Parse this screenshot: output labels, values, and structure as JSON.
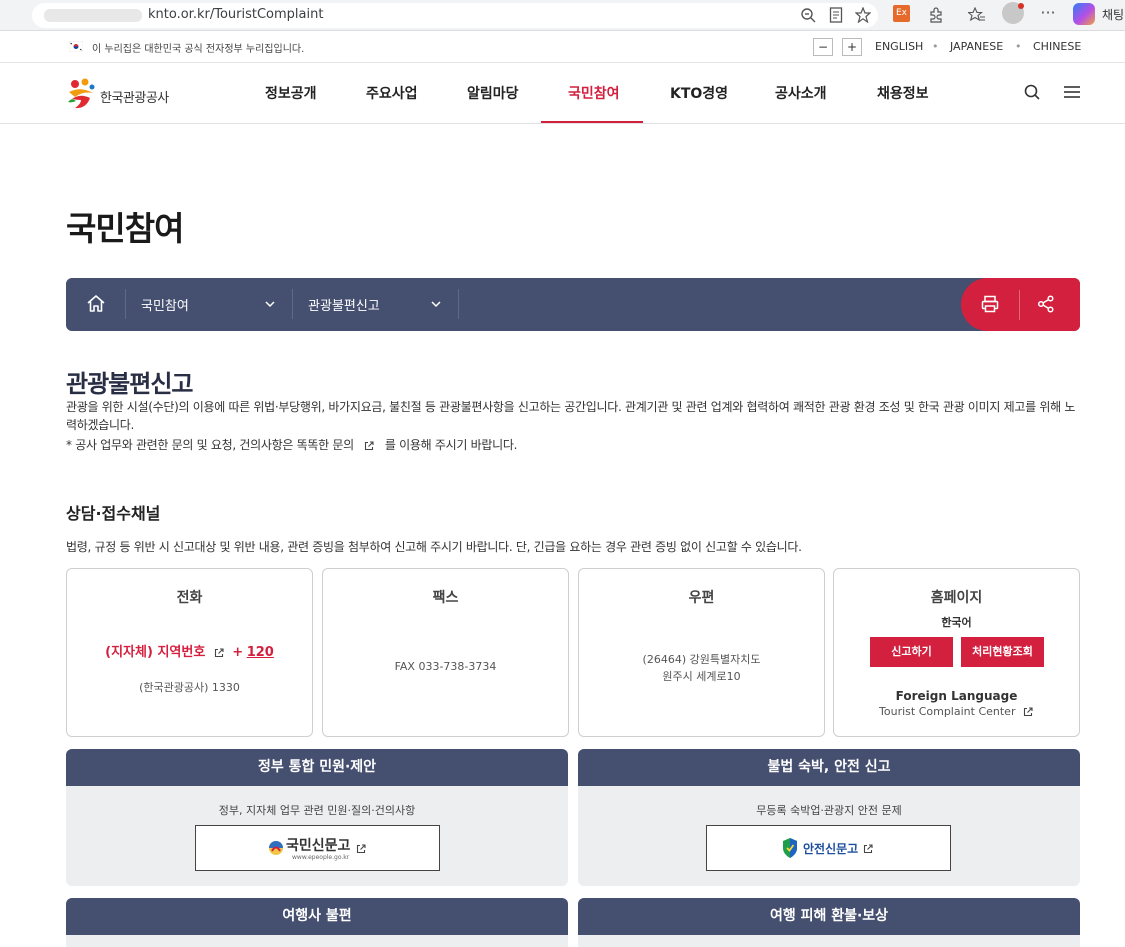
{
  "browser": {
    "url": "knto.or.kr/TouristComplaint",
    "ext_badge": "Ex",
    "chat_label": "채팅"
  },
  "gov": {
    "notice": "이 누리집은 대한민국 공식 전자정부 누리집입니다.",
    "font_minus": "−",
    "font_plus": "+",
    "languages": [
      "ENGLISH",
      "JAPANESE",
      "CHINESE"
    ]
  },
  "header": {
    "logo_text": "한국관광공사",
    "nav": [
      "정보공개",
      "주요사업",
      "알림마당",
      "국민참여",
      "KTO경영",
      "공사소개",
      "채용정보"
    ],
    "active_nav": "국민참여"
  },
  "page": {
    "title": "국민참여"
  },
  "breadcrumb": {
    "level1": "국민참여",
    "level2": "관광불편신고"
  },
  "section": {
    "title": "관광불편신고",
    "desc": "관광을 위한 시설(수단)의 이용에 따른 위법·부당행위, 바가지요금, 불친절 등 관광불편사항을 신고하는 공간입니다. 관계기관 및 관련 업계와 협력하여 쾌적한 관광 환경 조성 및 한국 관광 이미지 제고를 위해 노력하겠습니다.",
    "note_prefix": "* 공사 업무와 관련한 문의 및 요청, 건의사항은 똑똑한 문의",
    "note_suffix": "를 이용해 주시기 바랍니다."
  },
  "channels": {
    "title": "상담·접수채널",
    "desc": "법령, 규정 등 위반 시 신고대상 및 위반 내용, 관련 증빙을 첨부하여 신고해 주시기 바랍니다. 단, 긴급을 요하는 경우 관련 증빙 없이 신고할 수 있습니다.",
    "phone": {
      "title": "전화",
      "local_label": "(지자체) 지역번호",
      "plus": "+",
      "number": "120",
      "kto": "(한국관광공사) 1330"
    },
    "fax": {
      "title": "팩스",
      "number": "FAX 033-738-3734"
    },
    "mail": {
      "title": "우편",
      "line1": "(26464) 강원특별자치도",
      "line2": "원주시 세계로10"
    },
    "homepage": {
      "title": "홈페이지",
      "korean": "한국어",
      "report_btn": "신고하기",
      "status_btn": "처리현황조회",
      "foreign_title": "Foreign Language",
      "foreign_link": "Tourist Complaint Center"
    }
  },
  "panels": [
    {
      "title": "정부 통합 민원·제안",
      "desc": "정부, 지자체 업무 관련 민원·질의·건의사항",
      "logo_text": "국민신문고",
      "logo_sub": "www.epeople.go.kr"
    },
    {
      "title": "불법 숙박, 안전 신고",
      "desc": "무등록 숙박업·관광지 안전 문제",
      "logo_text": "안전신문고"
    },
    {
      "title": "여행사 불편"
    },
    {
      "title": "여행 피해 환불·보상"
    }
  ],
  "colors": {
    "accent": "#d4203f",
    "navy": "#454f6f",
    "panel_bg": "#eceef0"
  }
}
